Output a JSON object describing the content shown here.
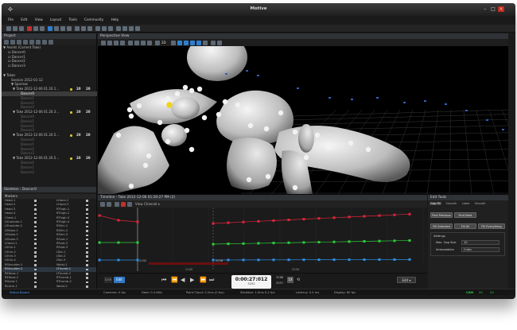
{
  "app": {
    "title": "Motive"
  },
  "menu": [
    "File",
    "Edit",
    "View",
    "Layout",
    "Tools",
    "Community",
    "Help"
  ],
  "project": {
    "header": "Project",
    "rows": [
      {
        "text": "▼ Assets (Current Take)",
        "indent": 2,
        "style": "normal"
      },
      {
        "text": "☑ Dancer0",
        "indent": 8,
        "style": "normal"
      },
      {
        "text": "☑ Dancer1",
        "indent": 8,
        "style": "normal"
      },
      {
        "text": "☑ Dancer2",
        "indent": 8,
        "style": "normal"
      },
      {
        "text": "☑ Dancer3",
        "indent": 8,
        "style": "normal"
      },
      {
        "text": "",
        "indent": 0,
        "style": "normal"
      },
      {
        "text": "▼ Takes",
        "indent": 2,
        "style": "normal"
      },
      {
        "text": "Session 2012-01-12",
        "indent": 12,
        "style": "normal"
      },
      {
        "text": "▼ Sparrow",
        "indent": 12,
        "style": "normal"
      },
      {
        "text": "▼ Take 2012-12-06 01.20.1...",
        "indent": 14,
        "style": "normal",
        "n1": "20",
        "n2": "20"
      },
      {
        "text": "Dancer0",
        "indent": 24,
        "style": "sel"
      },
      {
        "text": "Dancer1",
        "indent": 24,
        "style": "dim"
      },
      {
        "text": "Dancer2",
        "indent": 24,
        "style": "dim"
      },
      {
        "text": "Dancer3",
        "indent": 24,
        "style": "dim"
      },
      {
        "text": "▼ Take 2012-12-06 01.20.3...",
        "indent": 14,
        "style": "normal",
        "n1": "20",
        "n2": "20"
      },
      {
        "text": "Dancer0",
        "indent": 24,
        "style": "dim"
      },
      {
        "text": "Dancer1",
        "indent": 24,
        "style": "dim"
      },
      {
        "text": "Dancer2",
        "indent": 24,
        "style": "dim"
      },
      {
        "text": "Dancer3",
        "indent": 24,
        "style": "dim"
      },
      {
        "text": "▼ Take 2012-12-06 01.20.5...",
        "indent": 14,
        "style": "normal",
        "n1": "20",
        "n2": "20"
      },
      {
        "text": "Dancer0",
        "indent": 24,
        "style": "dim"
      },
      {
        "text": "Dancer1",
        "indent": 24,
        "style": "dim"
      },
      {
        "text": "Dancer2",
        "indent": 24,
        "style": "dim"
      },
      {
        "text": "Dancer3",
        "indent": 24,
        "style": "dim"
      },
      {
        "text": "▼ Take 2012-12-06 01.20.5...",
        "indent": 14,
        "style": "normal",
        "n1": "20",
        "n2": "20"
      },
      {
        "text": "Dancer0",
        "indent": 24,
        "style": "dim"
      },
      {
        "text": "Dancer1",
        "indent": 24,
        "style": "dim"
      },
      {
        "text": "Dancer2",
        "indent": 24,
        "style": "dim"
      }
    ]
  },
  "skeleton": {
    "header": "Skeleton : Dancer0",
    "markers_header": "Markers",
    "rows": [
      [
        "Head-1",
        "LHand-2"
      ],
      [
        "Head-2",
        "LHand-3"
      ],
      [
        "Head-3",
        "RThigh-1"
      ],
      [
        "Head-4",
        "RThigh-2"
      ],
      [
        "Chest-1",
        "RThigh-3"
      ],
      [
        "LShoulder-1",
        "RThigh-4"
      ],
      [
        "LShoulder-2",
        "RShin-1"
      ],
      [
        "LElbow-1",
        "RShin-2"
      ],
      [
        "LElbow-2",
        "RShin-3"
      ],
      [
        "LElbow-3",
        "RFoot-1"
      ],
      [
        "LHand-1",
        "RFoot-2"
      ],
      [
        "LShin-1",
        "RFoot-3"
      ],
      [
        "LShin-2",
        "LToe-1"
      ],
      [
        "LShin-3",
        "LToe-2"
      ],
      [
        "LShin-4",
        "LToe-3"
      ],
      [
        "RShoulder-1",
        "Waist-1"
      ],
      [
        "RShoulder-2",
        "LThumb-1"
      ],
      [
        "RElbow-1",
        "LThumb-2"
      ],
      [
        "RElbow-2",
        "RThumb-1"
      ],
      [
        "RHand-1",
        "RThumb-2"
      ],
      [
        "RLArm-1",
        "Waist-2"
      ],
      [
        "RLArm-2",
        "Waist-3"
      ]
    ]
  },
  "viewport": {
    "header": "Perspective View",
    "edit_label": "EDIT",
    "zoom": "2D"
  },
  "timeline": {
    "header": "Timeline - Take 2012-12-06 01:20:27 PM (2)",
    "view_label": "View",
    "channel_label": "Channel ▾",
    "gap_label_left": "2192",
    "gap_label_right": "2258",
    "tick_a": "2100",
    "tick_b": "2200",
    "colors": {
      "red": "#e0253a",
      "green": "#2dcf3a",
      "blue": "#2e8fe6"
    }
  },
  "transport": {
    "live": "Live",
    "edit": "Edit",
    "timecode": "0:00:27:012",
    "frame": "3252",
    "range_a": "3288",
    "range_b": "3357",
    "speed": "1X",
    "mode": "Edit ▾"
  },
  "edit_tools": {
    "header": "Edit Tools",
    "tabs": [
      "Gap Fill",
      "Smooth",
      "Label",
      "Smooth"
    ],
    "find_previous": "Find Previous",
    "find_next": "Find Next",
    "fill_selected": "Fill Selected",
    "fill_all": "Fill All",
    "fill_everything": "Fill Everything",
    "settings": "Settings",
    "max_gap_label": "Max. Gap Size",
    "max_gap_value": "10",
    "interp_label": "Interpolation",
    "interp_value": "Cubic"
  },
  "status": {
    "left": "Status Bound",
    "cameras": "Cameras: 0 fps",
    "data": "Data: 0.4 kB/s",
    "pointcloud": "Point Cloud: 0.2ms (0 fps)",
    "skeleton": "Skeleton: 1.0ms 0.2 fps",
    "latency": "Latency: 0.4 ms",
    "display": "Display: 60 fps",
    "cam_label": "CAM",
    "cam_a": "20",
    "cam_b": "20"
  }
}
